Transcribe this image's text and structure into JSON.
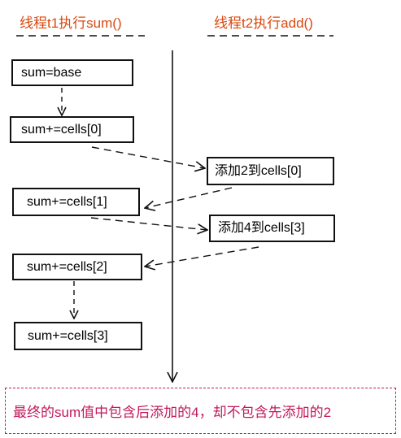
{
  "headers": {
    "t1": "线程t1执行sum()",
    "t2": "线程t2执行add()"
  },
  "t1_steps": [
    "sum=base",
    "sum+=cells[0]",
    "sum+=cells[1]",
    "sum+=cells[2]",
    "sum+=cells[3]"
  ],
  "t2_steps": [
    "添加2到cells[0]",
    "添加4到cells[3]"
  ],
  "note": "最终的sum值中包含后添加的4，却不包含先添加的2",
  "colors": {
    "header": "#d9480f",
    "note": "#c2185b",
    "line": "#111111"
  }
}
